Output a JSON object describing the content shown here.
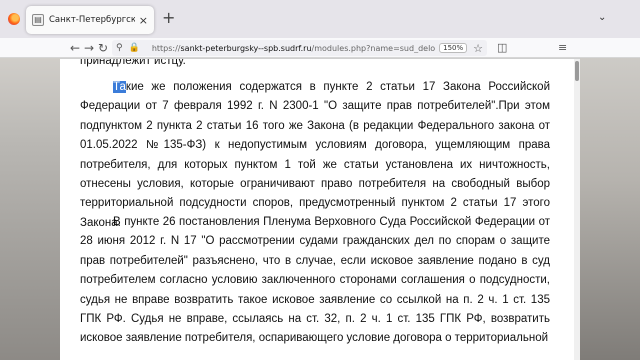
{
  "browser": {
    "tab": {
      "favicon_glyph": "▤",
      "title": "Санкт-Петербургский городс",
      "close_glyph": "×"
    },
    "new_tab_glyph": "+",
    "tab_list_glyph": "⌄",
    "nav": {
      "back": "←",
      "forward": "→",
      "reload": "↻"
    },
    "url": {
      "security_icon": "⚲",
      "lock_icon": "🔒",
      "full": "https://sankt-peterburgsky--spb.sudrf.ru/modules.php?name=sud_delo&",
      "prefix": "https://",
      "host": "sankt-peterburgsky--spb.sudrf.ru",
      "path": "/modules.php?name=sud_delo&"
    },
    "zoom": "150%",
    "bookmark_icon": "☆",
    "toolbar_icons": [
      "◫",
      "≡"
    ]
  },
  "document": {
    "cut_line": "принадлежит истцу.",
    "p1_highlight": "Та",
    "p1_rest": "кие же положения содержатся в пункте 2 статьи 17 Закона Российской Федерации от 7 февраля 1992 г. N 2300-1 \"О защите прав потребителей\".При этом подпунктом 2 пункта 2 статьи 16 того же Закона (в редакции Федерального закона от 01.05.2022 №135-ФЗ) к недопустимым условиям договора, ущемляющим права потребителя, для которых пунктом 1 той же статьи установлена их ничтожность, отнесены условия, которые ограничивают право потребителя на свободный выбор территориальной подсудности споров, предусмотренный пунктом 2 статьи 17 этого Закона.",
    "p2": "В пункте 26 постановления Пленума Верховного Суда Российской Федерации от 28 июня 2012 г. N 17 \"О рассмотрении судами гражданских дел по спорам о защите прав потребителей\" разъяснено, что в случае, если исковое заявление подано в суд потребителем согласно условию заключенного сторонами соглашения о подсудности, судья не вправе возвратить такое исковое заявление со ссылкой на п. 2 ч. 1 ст. 135 ГПК РФ. Судья не вправе, ссылаясь на ст. 32, п. 2 ч. 1 ст. 135 ГПК РФ, возвратить исковое заявление потребителя, оспаривающего условие договора о территориальной"
  }
}
